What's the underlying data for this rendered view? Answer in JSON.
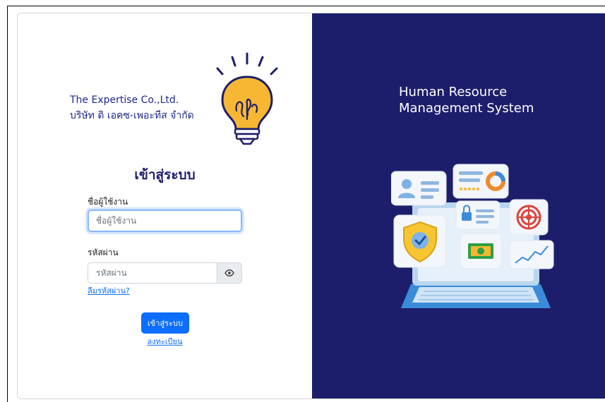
{
  "company": {
    "name_en": "The Expertise Co.,Ltd.",
    "name_th": "บริษัท ดิ เอคซ-เพอะทีส จำกัด"
  },
  "login": {
    "title": "เข้าสู่ระบบ",
    "username_label": "ชื่อผู้ใช้งาน",
    "username_placeholder": "ชื่อผู้ใช้งาน",
    "username_value": "",
    "password_label": "รหัสผ่าน",
    "password_placeholder": "รหัสผ่าน",
    "password_value": "",
    "forgot_link": "ลืมรหัสผ่าน?",
    "submit_label": "เข้าสู่ระบบ",
    "register_link": "ลงทะเบียน"
  },
  "system": {
    "title_line1": "Human Resource",
    "title_line2": "Management System"
  },
  "icons": {
    "logo": "lightbulb-icon",
    "password_toggle": "eye-icon",
    "illustration": "hr-laptop-illustration"
  },
  "colors": {
    "brand_navy": "#1d1e6b",
    "company_text": "#1d2a8a",
    "bulb_yellow": "#f7b733",
    "primary_button": "#0d6efd"
  }
}
